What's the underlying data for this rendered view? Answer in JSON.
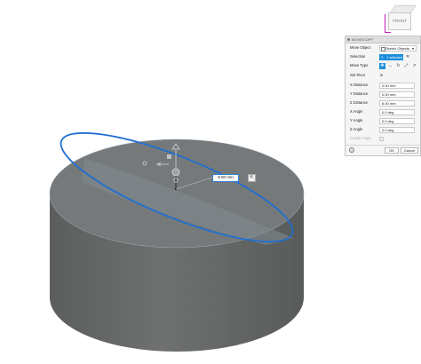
{
  "viewcube": {
    "face_label": "FRONT"
  },
  "dialog": {
    "title": "MOVE/COPY",
    "move_object": {
      "label": "Move Object",
      "value": "Sketch Objects",
      "caret": "▾"
    },
    "selection": {
      "label": "Selection",
      "value": "1 selected",
      "clear": "✕"
    },
    "move_type": {
      "label": "Move Type",
      "options": [
        "free-move-icon",
        "translate-icon",
        "rotate-icon",
        "point-to-point-icon",
        "point-to-position-icon"
      ],
      "active": 0
    },
    "set_pivot": {
      "label": "Set Pivot"
    },
    "x_distance": {
      "label": "X Distance",
      "value": "0.00 mm"
    },
    "y_distance": {
      "label": "Y Distance",
      "value": "0.00 mm"
    },
    "z_distance": {
      "label": "Z Distance",
      "value": "8.00 mm"
    },
    "x_angle": {
      "label": "X Angle",
      "value": "0.0 deg"
    },
    "y_angle": {
      "label": "Y Angle",
      "value": "0.0 deg"
    },
    "z_angle": {
      "label": "Z Angle",
      "value": "0.0 deg"
    },
    "create_copy": {
      "label": "Create Copy",
      "checked": false
    },
    "help": "?",
    "ok": "OK",
    "cancel": "Cancel"
  },
  "canvas": {
    "distance_value": "8.00 mm",
    "body_color": "#6a6d6b",
    "sketch_color": "#1f6fd1"
  }
}
